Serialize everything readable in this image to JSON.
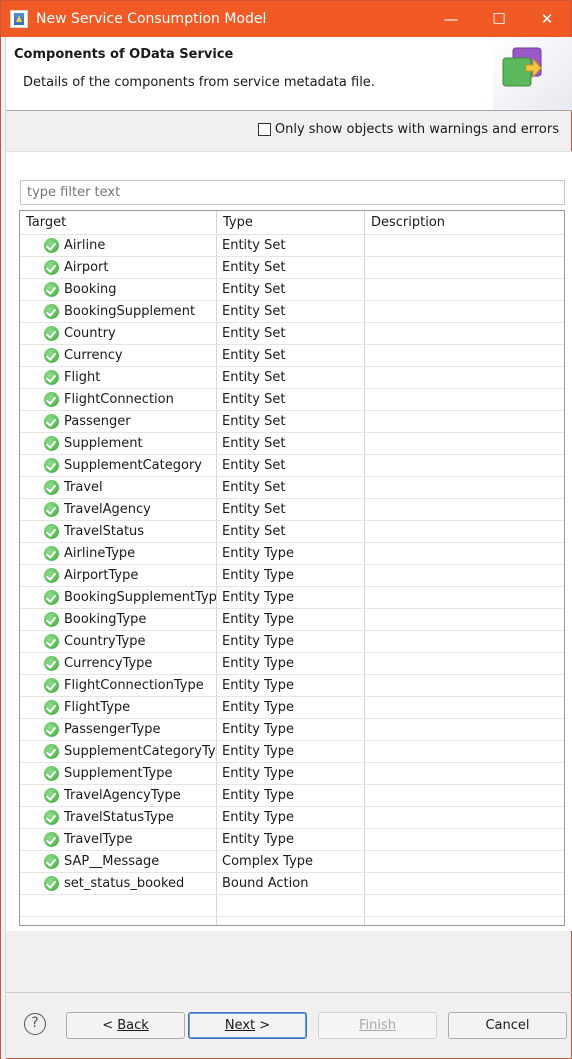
{
  "window": {
    "title": "New Service Consumption Model",
    "minimize": "—",
    "maximize": "☐",
    "close": "✕"
  },
  "header": {
    "title": "Components of OData Service",
    "description": "Details of the components from service metadata file."
  },
  "options": {
    "warnings_only_label": "Only show objects with warnings and errors",
    "warnings_only_checked": false
  },
  "filter": {
    "placeholder": "type filter text"
  },
  "table": {
    "columns": [
      "Target",
      "Type",
      "Description"
    ],
    "rows": [
      {
        "target": "Airline",
        "type": "Entity Set",
        "description": ""
      },
      {
        "target": "Airport",
        "type": "Entity Set",
        "description": ""
      },
      {
        "target": "Booking",
        "type": "Entity Set",
        "description": ""
      },
      {
        "target": "BookingSupplement",
        "type": "Entity Set",
        "description": ""
      },
      {
        "target": "Country",
        "type": "Entity Set",
        "description": ""
      },
      {
        "target": "Currency",
        "type": "Entity Set",
        "description": ""
      },
      {
        "target": "Flight",
        "type": "Entity Set",
        "description": ""
      },
      {
        "target": "FlightConnection",
        "type": "Entity Set",
        "description": ""
      },
      {
        "target": "Passenger",
        "type": "Entity Set",
        "description": ""
      },
      {
        "target": "Supplement",
        "type": "Entity Set",
        "description": ""
      },
      {
        "target": "SupplementCategory",
        "type": "Entity Set",
        "description": ""
      },
      {
        "target": "Travel",
        "type": "Entity Set",
        "description": ""
      },
      {
        "target": "TravelAgency",
        "type": "Entity Set",
        "description": ""
      },
      {
        "target": "TravelStatus",
        "type": "Entity Set",
        "description": ""
      },
      {
        "target": "AirlineType",
        "type": "Entity Type",
        "description": ""
      },
      {
        "target": "AirportType",
        "type": "Entity Type",
        "description": ""
      },
      {
        "target": "BookingSupplementType",
        "type": "Entity Type",
        "description": ""
      },
      {
        "target": "BookingType",
        "type": "Entity Type",
        "description": ""
      },
      {
        "target": "CountryType",
        "type": "Entity Type",
        "description": ""
      },
      {
        "target": "CurrencyType",
        "type": "Entity Type",
        "description": ""
      },
      {
        "target": "FlightConnectionType",
        "type": "Entity Type",
        "description": ""
      },
      {
        "target": "FlightType",
        "type": "Entity Type",
        "description": ""
      },
      {
        "target": "PassengerType",
        "type": "Entity Type",
        "description": ""
      },
      {
        "target": "SupplementCategoryType",
        "type": "Entity Type",
        "description": ""
      },
      {
        "target": "SupplementType",
        "type": "Entity Type",
        "description": ""
      },
      {
        "target": "TravelAgencyType",
        "type": "Entity Type",
        "description": ""
      },
      {
        "target": "TravelStatusType",
        "type": "Entity Type",
        "description": ""
      },
      {
        "target": "TravelType",
        "type": "Entity Type",
        "description": ""
      },
      {
        "target": "SAP__Message",
        "type": "Complex Type",
        "description": ""
      },
      {
        "target": "set_status_booked",
        "type": "Bound Action",
        "description": ""
      }
    ],
    "status_icon": "check-circle-icon",
    "status_color": "#4caf50"
  },
  "footer": {
    "help": "?",
    "back_label": "Back",
    "back_prefix": "< ",
    "next_label": "Next",
    "next_suffix": " >",
    "finish_label": "Finish",
    "cancel_label": "Cancel"
  },
  "colors": {
    "titlebar": "#f15a24",
    "default_button_border": "#3d6fbf"
  }
}
